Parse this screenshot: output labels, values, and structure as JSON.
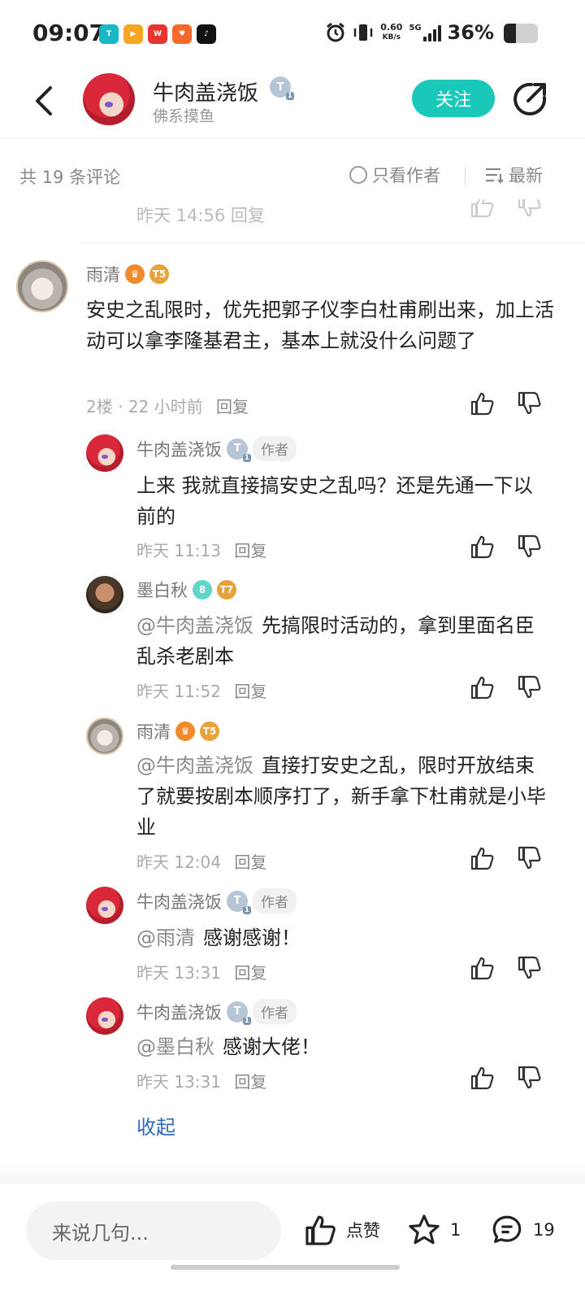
{
  "status_bar": {
    "time": "09:07",
    "net_speed_value": "0.60",
    "net_speed_unit": "KB/s",
    "network": "5G",
    "battery_pct": "36%",
    "battery_level": 0.36,
    "app_icons": [
      "taptap-icon",
      "video-icon",
      "weibo-icon",
      "app-icon",
      "tiktok-icon"
    ]
  },
  "header": {
    "author_name": "牛肉盖浇饭",
    "author_sub": "佛系摸鱼",
    "follow_label": "关注"
  },
  "sort_bar": {
    "count_text": "共 19 条评论",
    "author_only_label": "只看作者",
    "sort_label": "最新"
  },
  "partial_meta": "昨天 14:56   回复",
  "comments": [
    {
      "name": "雨清",
      "text": "安史之乱限时，优先把郭子仪李白杜甫刷出来，加上活动可以拿李隆基君主，基本上就没什么问题了",
      "floor": "2楼",
      "time": "22 小时前",
      "reply_label": "回复"
    },
    {
      "name": "牛肉盖浇饭",
      "tag": "作者",
      "text": "上来 我就直接搞安史之乱吗？还是先通一下以前的",
      "time": "昨天 11:13",
      "reply_label": "回复"
    },
    {
      "name": "墨白秋",
      "mention": "@牛肉盖浇饭",
      "text": "先搞限时活动的，拿到里面名臣乱杀老剧本",
      "time": "昨天 11:52",
      "reply_label": "回复"
    },
    {
      "name": "雨清",
      "mention": "@牛肉盖浇饭",
      "text": "直接打安史之乱，限时开放结束了就要按剧本顺序打了，新手拿下杜甫就是小毕业",
      "time": "昨天 12:04",
      "reply_label": "回复"
    },
    {
      "name": "牛肉盖浇饭",
      "tag": "作者",
      "mention": "@雨清",
      "text": "感谢感谢！",
      "time": "昨天 13:31",
      "reply_label": "回复"
    },
    {
      "name": "牛肉盖浇饭",
      "tag": "作者",
      "mention": "@墨白秋",
      "text": "感谢大佬！",
      "time": "昨天 13:31",
      "reply_label": "回复"
    }
  ],
  "collapse_label": "收起",
  "bottom_bar": {
    "input_placeholder": "来说几句...",
    "like_label": "点赞",
    "star_count": "1",
    "comment_count": "19"
  },
  "colors": {
    "accent": "#19c8b9",
    "link": "#2e6bb8"
  }
}
